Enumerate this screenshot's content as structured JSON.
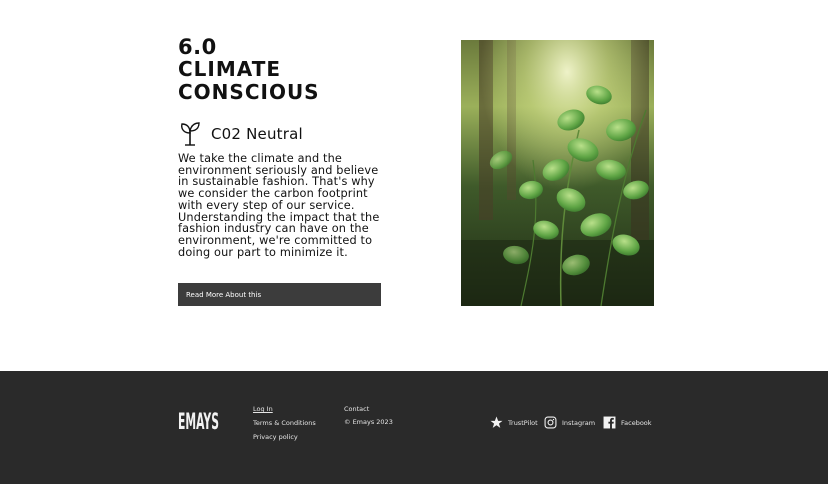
{
  "section": {
    "number": "6.0",
    "headline_line1": "CLIMATE",
    "headline_line2": "CONSCIOUS",
    "feature_icon": "sprout-icon",
    "feature_title": "C02 Neutral",
    "body": "We take the climate and the environment seriously and believe in sustainable fashion. That's why we consider the carbon footprint with every step of our service. Understanding the impact that the fashion industry can have on the environment, we're committed to doing our part to minimize it.",
    "cta_label": "Read More About this"
  },
  "footer": {
    "logo_text": "EMAYS",
    "links": {
      "login": "Log In",
      "terms": "Terms & Conditions",
      "privacy": "Privacy policy",
      "contact": "Contact",
      "copyright": "© Emays 2023"
    },
    "social": {
      "trustpilot": "TrustPilot",
      "instagram": "Instagram",
      "facebook": "Facebook"
    }
  },
  "colors": {
    "footer_bg": "#2a2a2a",
    "button_bg": "#3c3c3c",
    "text": "#111111"
  }
}
